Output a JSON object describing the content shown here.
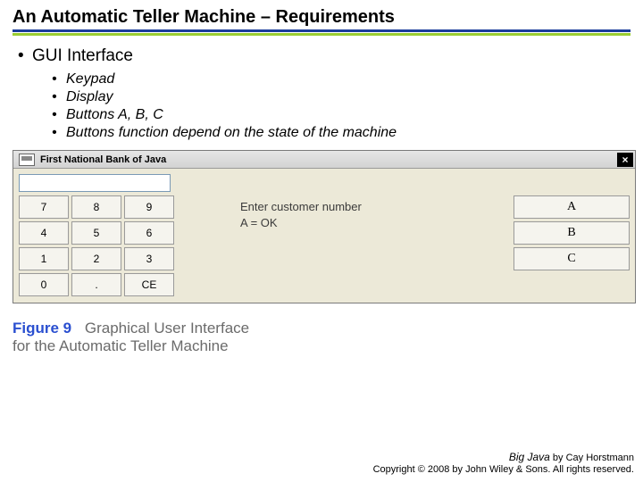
{
  "title": "An Automatic Teller Machine – Requirements",
  "main_bullet": "GUI Interface",
  "sub_bullets": [
    "Keypad",
    "Display",
    "Buttons A, B, C",
    "Buttons function depend on the state of the machine"
  ],
  "atm": {
    "window_title": "First National Bank of Java",
    "input_value": "",
    "keypad": [
      "7",
      "8",
      "9",
      "4",
      "5",
      "6",
      "1",
      "2",
      "3",
      "0",
      ".",
      "CE"
    ],
    "prompt_line1": "Enter customer number",
    "prompt_line2": "A = OK",
    "side_buttons": [
      "A",
      "B",
      "C"
    ]
  },
  "figure": {
    "label": "Figure 9",
    "caption_l1": "Graphical User Interface",
    "caption_l2": "for the Automatic Teller Machine"
  },
  "footer": {
    "line1_pre": "Big Java",
    "line1_post": " by Cay Horstmann",
    "line2": "Copyright © 2008 by John Wiley & Sons. All rights reserved."
  }
}
